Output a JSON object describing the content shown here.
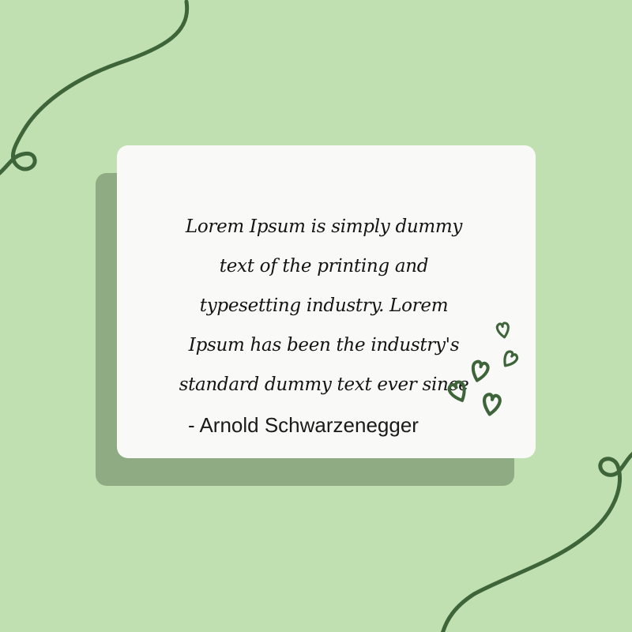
{
  "design": {
    "background_color": "#c1e0b1",
    "card_color": "#f9f9f7",
    "card_shadow_color": "#8fab84",
    "accent_color": "#3e6439",
    "quote": {
      "lines": [
        "Lorem Ipsum is simply dummy",
        "text of the printing and",
        "typesetting industry. Lorem",
        "Ipsum has been the industry's",
        "standard dummy text ever since"
      ]
    },
    "author": "- Arnold Schwarzenegger",
    "decorations": [
      "swirl-line-icon",
      "swirl-line-icon",
      "heart-icon",
      "heart-icon",
      "heart-icon",
      "heart-icon",
      "heart-icon"
    ]
  }
}
